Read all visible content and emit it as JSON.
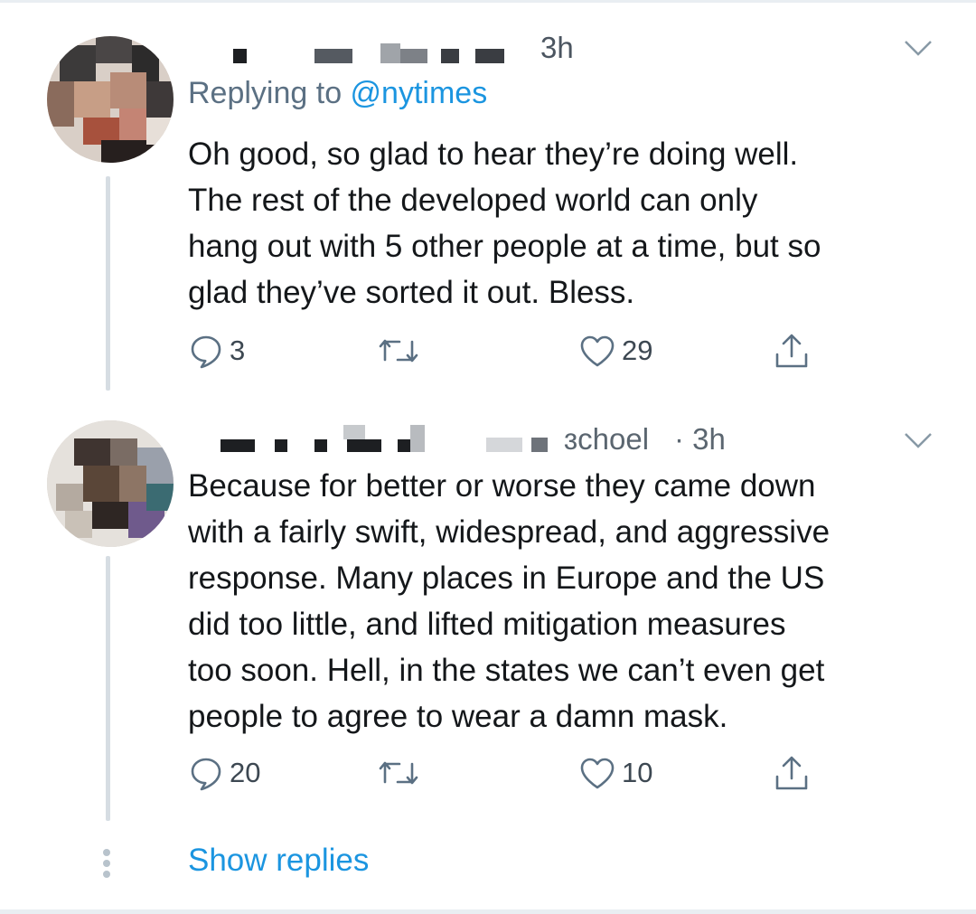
{
  "tweets": [
    {
      "time": "3h",
      "reply_prefix": "Replying to ",
      "reply_handle": "@nytimes",
      "body": "Oh good, so glad to hear they’re doing well.\nThe rest of the developed world can only\nhang out with 5 other people at a time, but so\nglad they’ve sorted it out. Bless.",
      "replies": "3",
      "retweets": "",
      "likes": "29"
    },
    {
      "name_suffix": "ɜchoel",
      "time": "· 3h",
      "body": "Because for better or worse they came down\nwith a fairly swift, widespread, and aggressive\nresponse. Many places in Europe and the US\ndid too little, and lifted mitigation measures\ntoo soon. Hell, in the states we can’t even get\npeople to agree to wear a damn mask.",
      "replies": "20",
      "retweets": "",
      "likes": "10"
    }
  ],
  "show_replies": "Show replies",
  "icons": {
    "reply": "reply-icon",
    "retweet": "retweet-icon",
    "like": "heart-icon",
    "share": "share-icon",
    "menu": "chevron-down-icon",
    "more": "vertical-dots-icon"
  },
  "colors": {
    "link": "#1b95e0",
    "text": "#14171a",
    "muted": "#5b7083",
    "icon": "#5b7083",
    "thread_line": "#d6dde3"
  }
}
